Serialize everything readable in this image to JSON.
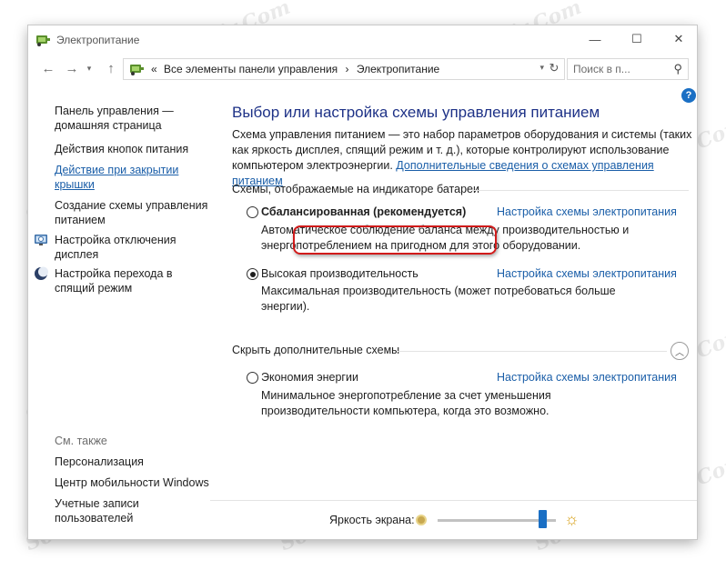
{
  "window": {
    "title": "Электропитание",
    "controls": {
      "minimize": "—",
      "maximize": "☐",
      "close": "✕"
    }
  },
  "address": {
    "prefix": "«",
    "crumb1": "Все элементы панели управления",
    "separator": "›",
    "crumb2": "Электропитание",
    "search_placeholder": "Поиск в п..."
  },
  "left": {
    "home_line1": "Панель управления —",
    "home_line2": "домашняя страница",
    "power_buttons": "Действия кнопок питания",
    "lid_line1": "Действие при закрытии",
    "lid_line2": "крышки",
    "create_line1": "Создание схемы управления",
    "create_line2": "питанием",
    "display_line1": "Настройка отключения",
    "display_line2": "дисплея",
    "sleep_line1": "Настройка перехода в",
    "sleep_line2": "спящий режим",
    "see_also": "См. также",
    "personalization": "Персонализация",
    "mobility": "Центр мобильности Windows",
    "accounts_line1": "Учетные записи",
    "accounts_line2": "пользователей"
  },
  "main": {
    "title": "Выбор или настройка схемы управления питанием",
    "intro_text": "Схема управления питанием — это набор параметров оборудования и системы (таких как яркость дисплея, спящий режим и т. д.), которые контролируют использование компьютером электроэнергии. ",
    "intro_link": "Дополнительные сведения о схемах управления питанием",
    "group_battery": "Схемы, отображаемые на индикаторе батареи",
    "group_hidden": "Скрыть дополнительные схемы",
    "plans": [
      {
        "name": "Сбалансированная (рекомендуется)",
        "link": "Настройка схемы электропитания",
        "desc": "Автоматическое соблюдение баланса между производительностью и энергопотреблением на пригодном для этого оборудовании.",
        "selected": false
      },
      {
        "name": "Высокая производительность",
        "link": "Настройка схемы электропитания",
        "desc": "Максимальная производительность (может потребоваться больше энергии).",
        "selected": true
      },
      {
        "name": "Экономия энергии",
        "link": "Настройка схемы электропитания",
        "desc": "Минимальное энергопотребление за счет уменьшения производительности компьютера, когда это возможно.",
        "selected": false
      }
    ]
  },
  "brightness": {
    "label": "Яркость экрана:",
    "level": 0.92
  },
  "watermark": "Soringpcrepair.Com",
  "colors": {
    "accent": "#1a6fc4",
    "link": "#1a5ea8",
    "title": "#1e3287",
    "highlight": "#d11a1a"
  }
}
